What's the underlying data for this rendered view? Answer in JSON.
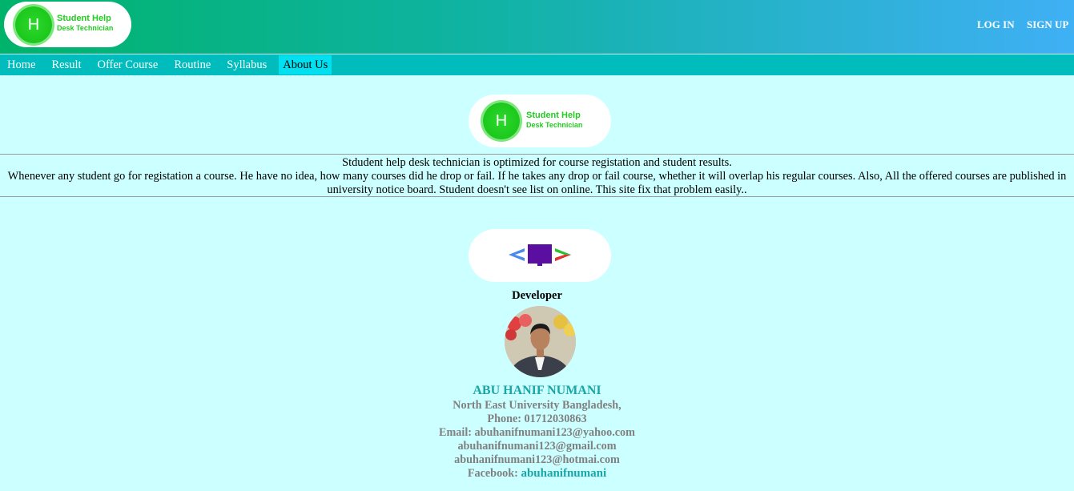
{
  "brand": {
    "logo_letter": "H",
    "line1": "Student Help",
    "line2": "Desk Technician"
  },
  "auth": {
    "login": "LOG IN",
    "signup": "SIGN UP"
  },
  "nav": {
    "items": [
      "Home",
      "Result",
      "Offer Course",
      "Routine",
      "Syllabus",
      "About Us"
    ],
    "active": "About Us"
  },
  "about": {
    "line1": "Stdudent help desk technician is optimized for course registation and student results.",
    "line2": "Whenever any student go for registation a course. He have no idea, how many courses did he drop or fail. If he takes any drop or fail course, whether it will overlap his regular courses. Also, All the offered courses are published in university notice board. Student doesn't see list on online. This site fix that problem easily.."
  },
  "developer": {
    "label": "Developer",
    "name": "ABU HANIF NUMANI",
    "university": "North East University Bangladesh,",
    "phone": "Phone: 01712030863",
    "email1": "Email: abuhanifnumani123@yahoo.com",
    "email2": "abuhanifnumani123@gmail.com",
    "email3": "abuhanifnumani123@hotmai.com",
    "facebook_label": "Facebook:",
    "facebook_handle": "abuhanifnumani"
  },
  "colors": {
    "header_start": "#00b36b",
    "header_end": "#3fb0f5",
    "nav": "#00bcbc",
    "nav_active": "#00e0f0",
    "page_bg": "#ccffff",
    "accent": "#1aa6a6",
    "logo_green": "#22cc22"
  }
}
